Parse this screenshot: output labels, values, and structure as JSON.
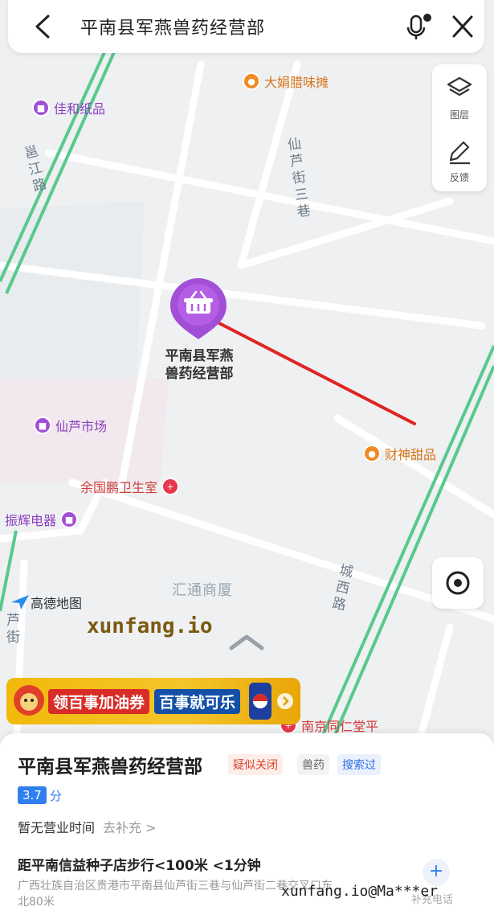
{
  "search": {
    "query": "平南县军燕兽药经营部"
  },
  "tools": {
    "layers_label": "图层",
    "feedback_label": "反馈"
  },
  "pois": [
    {
      "name": "大娟腊味摊",
      "kind": "orange"
    },
    {
      "name": "佳和纸品",
      "kind": "purple"
    },
    {
      "name": "仙芦市场",
      "kind": "purple"
    },
    {
      "name": "余国鹏卫生室",
      "kind": "red"
    },
    {
      "name": "振辉电器",
      "kind": "purple"
    },
    {
      "name": "财神甜品",
      "kind": "orange"
    },
    {
      "name": "南京同仁堂平",
      "kind": "red"
    }
  ],
  "streets": {
    "xianlu3": "仙芦街三巷",
    "west": "邕江路",
    "chengxi": "城西路",
    "lu": "芦街"
  },
  "pin": {
    "label_line1": "平南县军燕",
    "label_line2": "兽药经营部",
    "color": "#a24ed6"
  },
  "building": "汇通商厦",
  "map_brand": "高德地图",
  "watermark_site": "xunfang.io",
  "ad": {
    "text1": "领百事加油券",
    "text2": "百事就可乐"
  },
  "place": {
    "name": "平南县军燕兽药经营部",
    "status": "疑似关闭",
    "category": "兽药",
    "searched": "搜索过",
    "rating": "3.7",
    "rating_unit": "分",
    "hours": "暂无营业时间",
    "hours_action": "去补充 >",
    "distance": "距平南信益种子店步行<100米 <1分钟",
    "address": "广西壮族自治区贵港市平南县仙芦街三巷与仙芦街二巷交叉口东北80米",
    "supplement_phone": "补充电话"
  },
  "watermark_user": "xunfang.io@Ma***er",
  "colors": {
    "route_line": "#e02424",
    "road_green": "#58c98c",
    "accent_blue": "#2f7ff0"
  }
}
